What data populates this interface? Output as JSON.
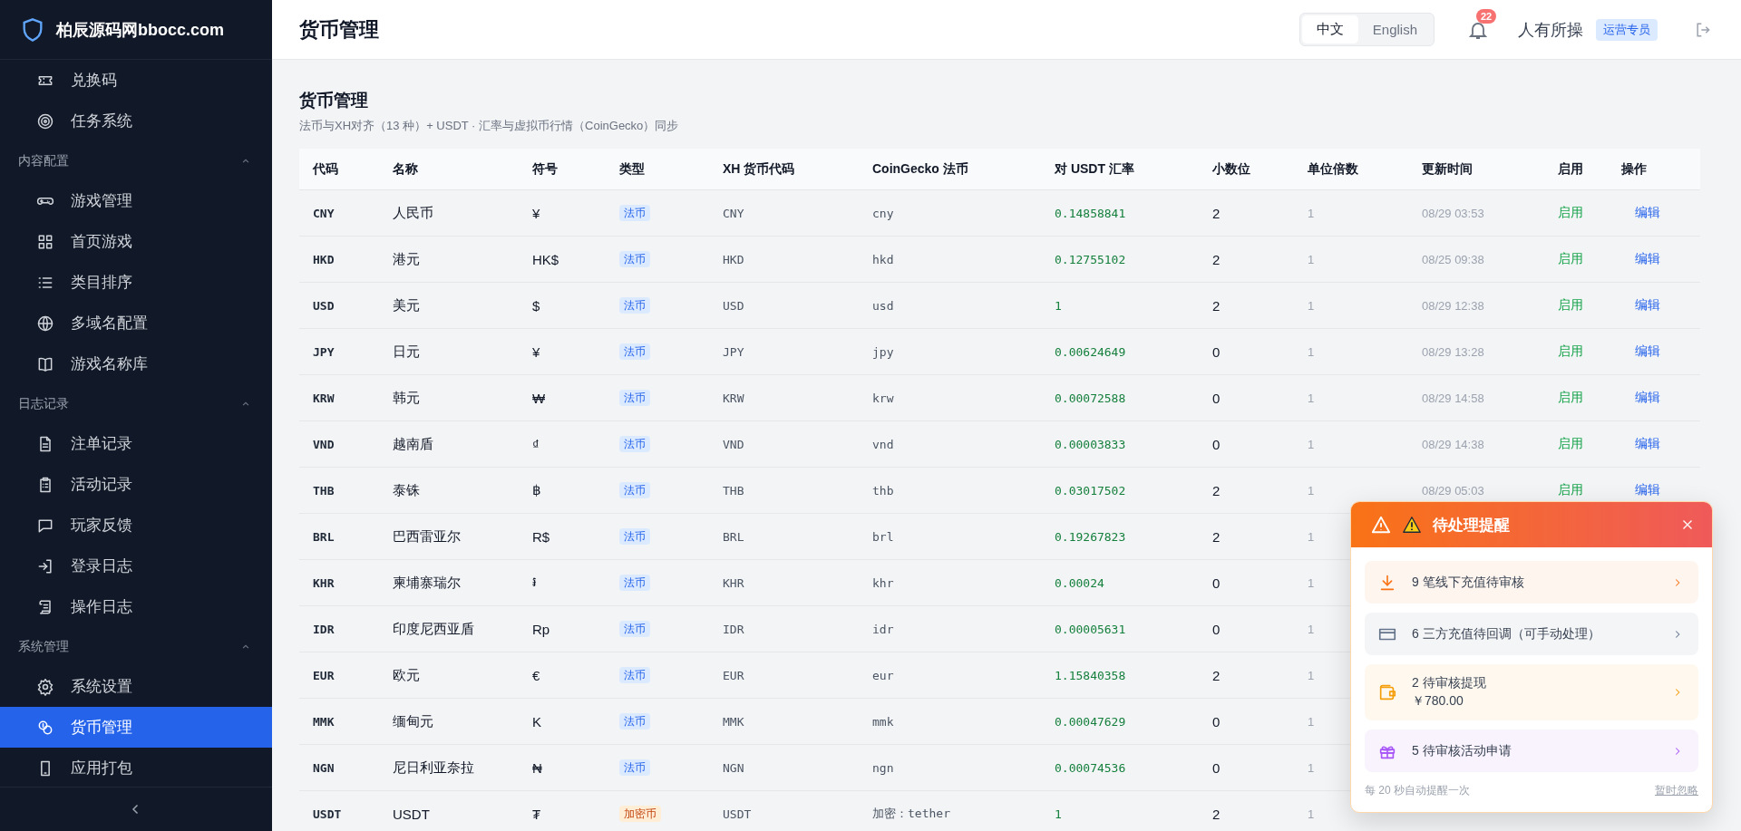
{
  "brand": {
    "name": "柏辰源码网bbocc.com"
  },
  "sidebar": {
    "groups": [
      {
        "items": [
          {
            "label": "兑换码",
            "kind": "ticket",
            "selected": false
          },
          {
            "label": "任务系统",
            "kind": "target",
            "selected": false
          }
        ]
      },
      {
        "title": "内容配置",
        "expanded": true,
        "items": [
          {
            "label": "游戏管理",
            "kind": "gamepad",
            "selected": false
          },
          {
            "label": "首页游戏",
            "kind": "grid",
            "selected": false
          },
          {
            "label": "类目排序",
            "kind": "list",
            "selected": false
          },
          {
            "label": "多域名配置",
            "kind": "globe",
            "selected": false
          },
          {
            "label": "游戏名称库",
            "kind": "book",
            "selected": false
          }
        ]
      },
      {
        "title": "日志记录",
        "expanded": true,
        "items": [
          {
            "label": "注单记录",
            "kind": "file",
            "selected": false
          },
          {
            "label": "活动记录",
            "kind": "clipboard",
            "selected": false
          },
          {
            "label": "玩家反馈",
            "kind": "message",
            "selected": false
          },
          {
            "label": "登录日志",
            "kind": "login",
            "selected": false
          },
          {
            "label": "操作日志",
            "kind": "scroll",
            "selected": false
          }
        ]
      },
      {
        "title": "系统管理",
        "expanded": true,
        "items": [
          {
            "label": "系统设置",
            "kind": "gear",
            "selected": false
          },
          {
            "label": "货币管理",
            "kind": "coins",
            "selected": true
          },
          {
            "label": "应用打包",
            "kind": "phone",
            "selected": false
          }
        ]
      }
    ]
  },
  "header": {
    "title": "货币管理",
    "languages": [
      {
        "label": "中文",
        "selected": true
      },
      {
        "label": "English",
        "selected": false
      }
    ],
    "notifications": "22",
    "user": "人有所操",
    "role": "运营专员"
  },
  "page": {
    "title": "货币管理",
    "subtitle": "法币与XH对齐（13 种）+ USDT · 汇率与虚拟币行情（CoinGecko）同步"
  },
  "table": {
    "columns": [
      "代码",
      "名称",
      "符号",
      "类型",
      "XH 货币代码",
      "CoinGecko 法币",
      "对 USDT 汇率",
      "小数位",
      "单位倍数",
      "更新时间",
      "启用",
      "操作"
    ],
    "rows": [
      {
        "code": "CNY",
        "name": "人民币",
        "symbol": "¥",
        "type": {
          "label": "法币",
          "kind": "fiat"
        },
        "xh_code": "CNY",
        "coingecko": "cny",
        "rate": "0.14858841",
        "decimals": "2",
        "multiplier": "1",
        "updated": "08/29 03:53",
        "status": "启用",
        "action": "编辑"
      },
      {
        "code": "HKD",
        "name": "港元",
        "symbol": "HK$",
        "type": {
          "label": "法币",
          "kind": "fiat"
        },
        "xh_code": "HKD",
        "coingecko": "hkd",
        "rate": "0.12755102",
        "decimals": "2",
        "multiplier": "1",
        "updated": "08/25 09:38",
        "status": "启用",
        "action": "编辑"
      },
      {
        "code": "USD",
        "name": "美元",
        "symbol": "$",
        "type": {
          "label": "法币",
          "kind": "fiat"
        },
        "xh_code": "USD",
        "coingecko": "usd",
        "rate": "1",
        "decimals": "2",
        "multiplier": "1",
        "updated": "08/29 12:38",
        "status": "启用",
        "action": "编辑"
      },
      {
        "code": "JPY",
        "name": "日元",
        "symbol": "¥",
        "type": {
          "label": "法币",
          "kind": "fiat"
        },
        "xh_code": "JPY",
        "coingecko": "jpy",
        "rate": "0.00624649",
        "decimals": "0",
        "multiplier": "1",
        "updated": "08/29 13:28",
        "status": "启用",
        "action": "编辑"
      },
      {
        "code": "KRW",
        "name": "韩元",
        "symbol": "₩",
        "type": {
          "label": "法币",
          "kind": "fiat"
        },
        "xh_code": "KRW",
        "coingecko": "krw",
        "rate": "0.00072588",
        "decimals": "0",
        "multiplier": "1",
        "updated": "08/29 14:58",
        "status": "启用",
        "action": "编辑"
      },
      {
        "code": "VND",
        "name": "越南盾",
        "symbol": "₫",
        "type": {
          "label": "法币",
          "kind": "fiat"
        },
        "xh_code": "VND",
        "coingecko": "vnd",
        "rate": "0.00003833",
        "decimals": "0",
        "multiplier": "1",
        "updated": "08/29 14:38",
        "status": "启用",
        "action": "编辑"
      },
      {
        "code": "THB",
        "name": "泰铢",
        "symbol": "฿",
        "type": {
          "label": "法币",
          "kind": "fiat"
        },
        "xh_code": "THB",
        "coingecko": "thb",
        "rate": "0.03017502",
        "decimals": "2",
        "multiplier": "1",
        "updated": "08/29 05:03",
        "status": "启用",
        "action": "编辑"
      },
      {
        "code": "BRL",
        "name": "巴西雷亚尔",
        "symbol": "R$",
        "type": {
          "label": "法币",
          "kind": "fiat"
        },
        "xh_code": "BRL",
        "coingecko": "brl",
        "rate": "0.19267823",
        "decimals": "2",
        "multiplier": "1"
      },
      {
        "code": "KHR",
        "name": "柬埔寨瑞尔",
        "symbol": "៛",
        "type": {
          "label": "法币",
          "kind": "fiat"
        },
        "xh_code": "KHR",
        "coingecko": "khr",
        "rate": "0.00024",
        "decimals": "0",
        "multiplier": "1"
      },
      {
        "code": "IDR",
        "name": "印度尼西亚盾",
        "symbol": "Rp",
        "type": {
          "label": "法币",
          "kind": "fiat"
        },
        "xh_code": "IDR",
        "coingecko": "idr",
        "rate": "0.00005631",
        "decimals": "0",
        "multiplier": "1"
      },
      {
        "code": "EUR",
        "name": "欧元",
        "symbol": "€",
        "type": {
          "label": "法币",
          "kind": "fiat"
        },
        "xh_code": "EUR",
        "coingecko": "eur",
        "rate": "1.15840358",
        "decimals": "2",
        "multiplier": "1"
      },
      {
        "code": "MMK",
        "name": "缅甸元",
        "symbol": "K",
        "type": {
          "label": "法币",
          "kind": "fiat"
        },
        "xh_code": "MMK",
        "coingecko": "mmk",
        "rate": "0.00047629",
        "decimals": "0",
        "multiplier": "1"
      },
      {
        "code": "NGN",
        "name": "尼日利亚奈拉",
        "symbol": "₦",
        "type": {
          "label": "法币",
          "kind": "fiat"
        },
        "xh_code": "NGN",
        "coingecko": "ngn",
        "rate": "0.00074536",
        "decimals": "0",
        "multiplier": "1"
      },
      {
        "code": "USDT",
        "name": "USDT",
        "symbol": "₮",
        "type": {
          "label": "加密币",
          "kind": "crypto"
        },
        "xh_code": "USDT",
        "coingecko": "加密：tether",
        "rate": "1",
        "decimals": "2",
        "multiplier": "1"
      }
    ]
  },
  "popup": {
    "title": "待处理提醒",
    "items": [
      {
        "kind": "download",
        "color": "#f97316",
        "text": "9 笔线下充值待审核"
      },
      {
        "kind": "card",
        "color": "#64748b",
        "text": "6 三方充值待回调（可手动处理）"
      },
      {
        "kind": "wallet",
        "color": "#f59e0b",
        "text": "2 待审核提现",
        "amount": "￥780.00"
      },
      {
        "kind": "gift",
        "color": "#a855f7",
        "text": "5 待审核活动申请"
      }
    ],
    "footer": "每 20 秒自动提醒一次",
    "dismiss": "暂时忽略"
  }
}
